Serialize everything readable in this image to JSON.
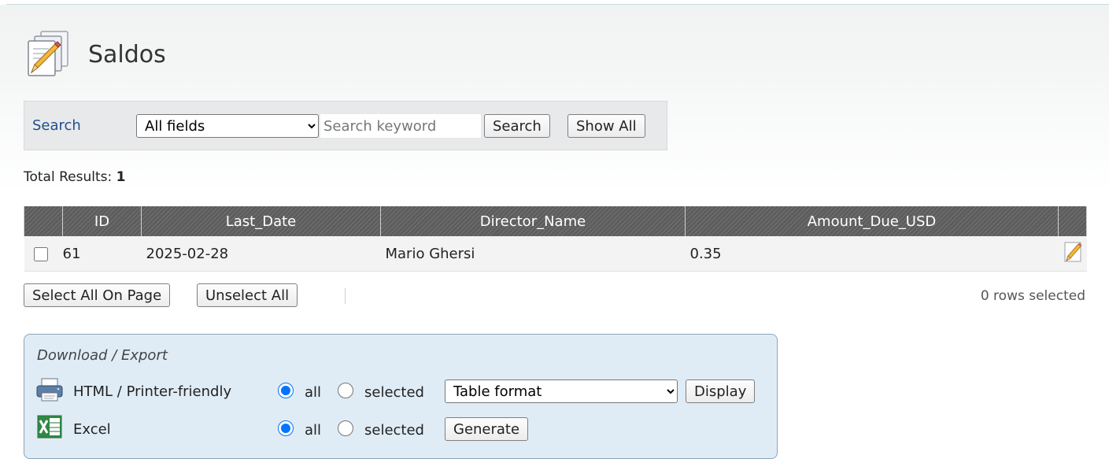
{
  "page": {
    "title": "Saldos"
  },
  "search": {
    "link_label": "Search",
    "field_selected": "All fields",
    "keyword_placeholder": "Search keyword",
    "search_button": "Search",
    "show_all_button": "Show All"
  },
  "results": {
    "label": "Total Results:",
    "count": "1"
  },
  "table": {
    "columns": [
      "ID",
      "Last_Date",
      "Director_Name",
      "Amount_Due_USD"
    ],
    "rows": [
      {
        "id": "61",
        "last_date": "2025-02-28",
        "director_name": "Mario Ghersi",
        "amount_due_usd": "0.35"
      }
    ]
  },
  "selection": {
    "select_all_button": "Select All On Page",
    "unselect_all_button": "Unselect All",
    "status": "0 rows selected"
  },
  "export": {
    "title": "Download / Export",
    "html_label": "HTML / Printer-friendly",
    "excel_label": "Excel",
    "all_label": "all",
    "selected_label": "selected",
    "format_selected": "Table format",
    "display_button": "Display",
    "generate_button": "Generate"
  },
  "icons": {
    "title": "document-edit-icon",
    "edit": "pencil-icon",
    "printer": "printer-icon",
    "excel": "excel-icon"
  },
  "colors": {
    "link": "#1f4e8c",
    "header_bg": "#5d5d5d",
    "export_bg": "#dfecf6",
    "excel_green": "#1e7b34"
  }
}
